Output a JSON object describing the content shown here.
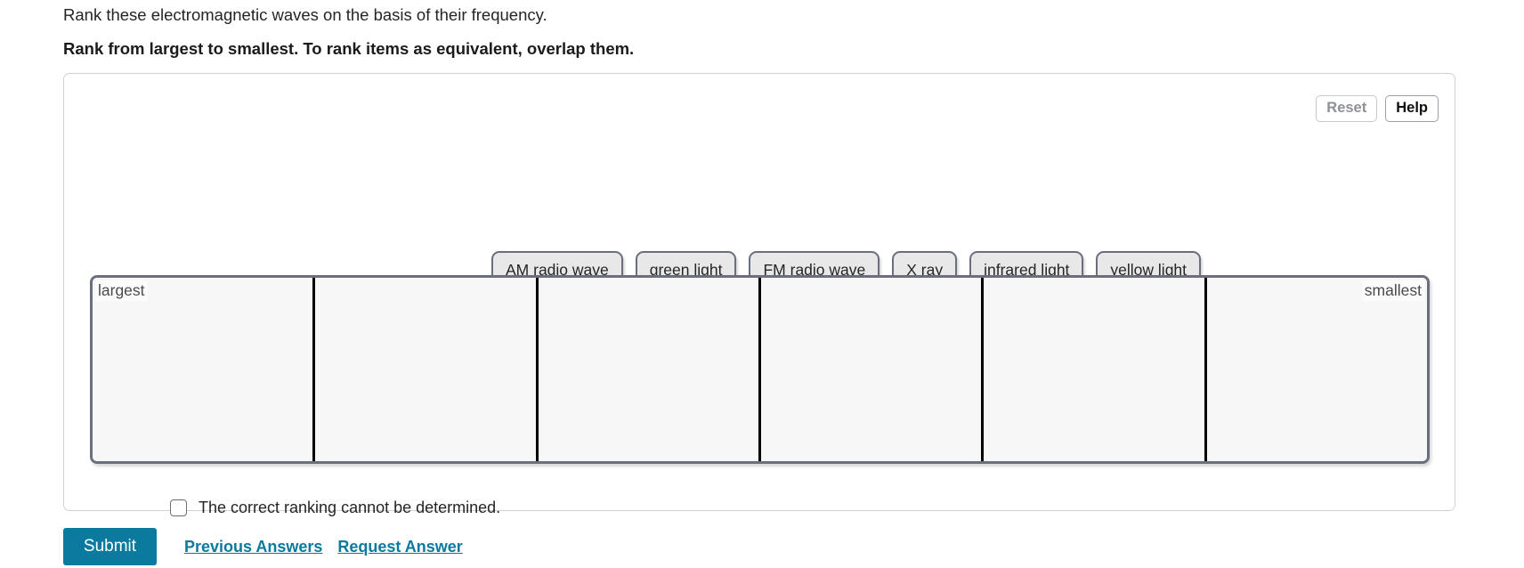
{
  "question": {
    "prompt": "Rank these electromagnetic waves on the basis of their frequency.",
    "instruction": "Rank from largest to smallest. To rank items as equivalent, overlap them."
  },
  "toolbar": {
    "reset_label": "Reset",
    "help_label": "Help"
  },
  "tiles": [
    {
      "label": "AM radio wave"
    },
    {
      "label": "green light"
    },
    {
      "label": "FM radio wave"
    },
    {
      "label": "X ray"
    },
    {
      "label": "infrared light"
    },
    {
      "label": "yellow light"
    }
  ],
  "bins": {
    "count": 6,
    "left_label": "largest",
    "right_label": "smallest"
  },
  "undetermined": {
    "label": "The correct ranking cannot be determined.",
    "checked": false
  },
  "footer": {
    "submit_label": "Submit",
    "previous_answers_label": "Previous Answers",
    "request_answer_label": "Request Answer"
  },
  "colors": {
    "accent": "#0b7a9e",
    "tile_border": "#6b6e7c",
    "tile_fill": "#e8e8e8",
    "bin_fill": "#f7f7f7",
    "divider": "#000000"
  }
}
